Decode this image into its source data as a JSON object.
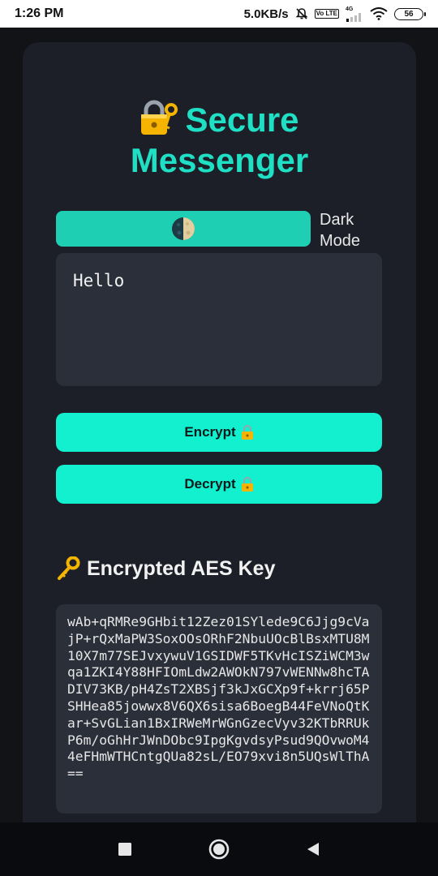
{
  "status_bar": {
    "time": "1:26 PM",
    "net_speed": "5.0KB/s",
    "network_badge": "Vo LTE",
    "network_type": "4G",
    "battery": "56"
  },
  "app": {
    "title_line1": "Secure",
    "title_line2": "Messenger",
    "title_icon": "locked-with-key-icon",
    "accent_color": "#1fe0c4",
    "button_color": "#12f0d0"
  },
  "theme_toggle": {
    "icon": "moon-icon",
    "label": "Dark Mode"
  },
  "message_input": {
    "value": "Hello"
  },
  "buttons": {
    "encrypt_label": "Encrypt",
    "decrypt_label": "Decrypt",
    "icon": "padlock-icon"
  },
  "aes_section": {
    "title": "Encrypted AES Key",
    "icon": "key-icon",
    "value": "wAb+qRMRe9GHbit12Zez01SYlede9C6Jjg9cVajP+rQxMaPW3SoxOOsORhF2NbuUOcBlBsxMTU8M10X7m77SEJvxywuV1GSIDWF5TKvHcISZiWCM3wqa1ZKI4Y88HFIOmLdw2AWOkN797vWENNw8hcTADIV73KB/pH4ZsT2XBSjf3kJxGCXp9f+krrj65PSHHea85jowwx8V6QX6sisa6BoegB44FeVNoQtKar+SvGLian1BxIRWeMrWGnGzecVyv32KTbRRUkP6m/oGhHrJWnDObc9IpgKgvdsyPsud9QOvwoM44eFHmWTHCntgQUa82sL/EO79xvi8n5UQsWlThA=="
  },
  "nav_bar": {
    "items": [
      "recents-icon",
      "home-icon",
      "back-icon"
    ]
  }
}
